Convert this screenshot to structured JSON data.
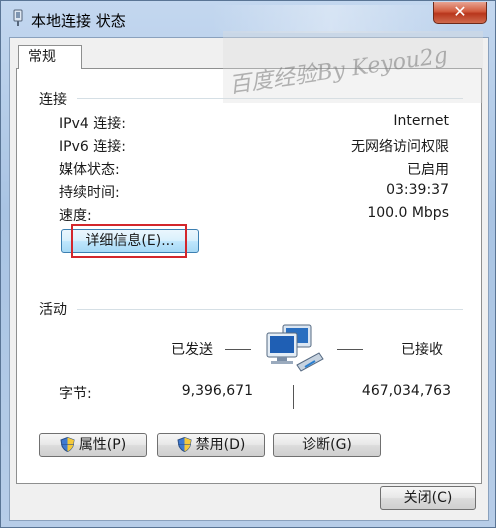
{
  "window": {
    "title": "本地连接 状态",
    "close_symbol": "✕"
  },
  "tab": {
    "label": "常规"
  },
  "connection": {
    "group_label": "连接",
    "rows": [
      {
        "label": "IPv4 连接:",
        "value": "Internet"
      },
      {
        "label": "IPv6 连接:",
        "value": "无网络访问权限"
      },
      {
        "label": "媒体状态:",
        "value": "已启用"
      },
      {
        "label": "持续时间:",
        "value": "03:39:37"
      },
      {
        "label": "速度:",
        "value": "100.0 Mbps"
      }
    ],
    "details_button": "详细信息(E)..."
  },
  "activity": {
    "group_label": "活动",
    "sent_label": "已发送",
    "received_label": "已接收",
    "bytes_label": "字节:",
    "bytes_sent": "9,396,671",
    "bytes_received": "467,034,763"
  },
  "buttons": {
    "properties": "属性(P)",
    "disable": "禁用(D)",
    "diagnose": "诊断(G)",
    "close": "关闭(C)"
  },
  "watermark": {
    "text": "百度经验By Keyou2g"
  },
  "colors": {
    "highlight": "#d3262b",
    "details_button": "#bee6fd"
  }
}
